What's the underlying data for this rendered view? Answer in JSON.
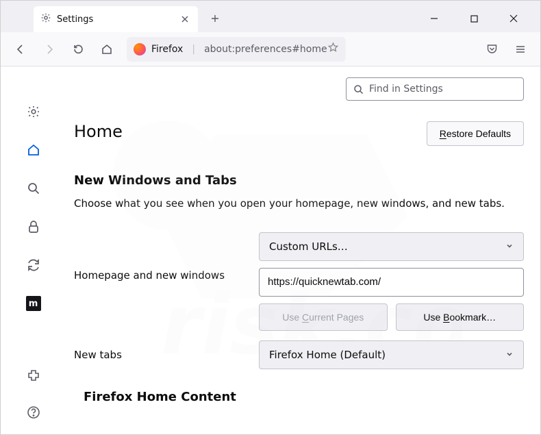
{
  "tab": {
    "title": "Settings"
  },
  "urlbar": {
    "identity": "Firefox",
    "url_path": "about:preferences#home"
  },
  "search": {
    "placeholder": "Find in Settings"
  },
  "header": {
    "title": "Home",
    "restore": "Restore Defaults"
  },
  "section": {
    "title": "New Windows and Tabs",
    "desc": "Choose what you see when you open your homepage, new windows, and new tabs."
  },
  "homepage": {
    "label": "Homepage and new windows",
    "select": "Custom URLs…",
    "url": "https://quicknewtab.com/",
    "use_current": "Use Current Pages",
    "use_bookmark": "Use Bookmark…"
  },
  "newtabs": {
    "label": "New tabs",
    "select": "Firefox Home (Default)"
  },
  "section2": {
    "title": "Firefox Home Content"
  }
}
